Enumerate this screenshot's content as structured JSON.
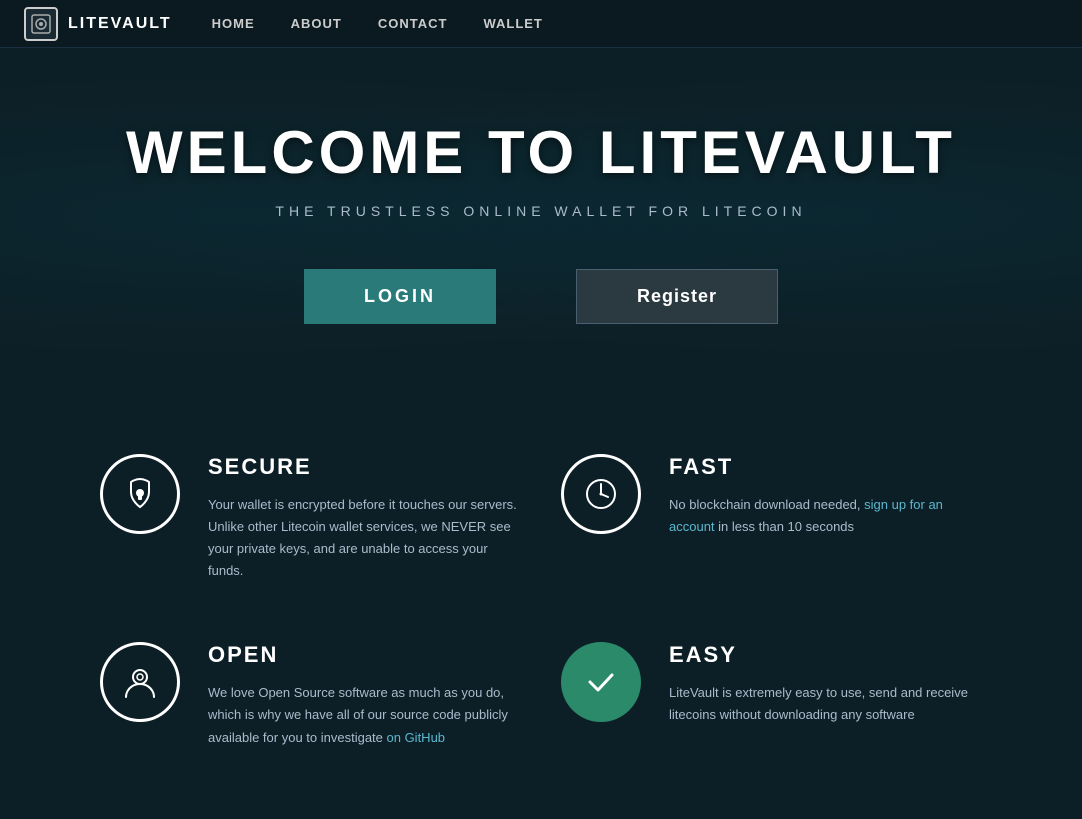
{
  "nav": {
    "logo_text": "LITEVAULT",
    "links": [
      {
        "label": "HOME",
        "id": "home"
      },
      {
        "label": "ABOUT",
        "id": "about"
      },
      {
        "label": "CONTACT",
        "id": "contact"
      },
      {
        "label": "WALLET",
        "id": "wallet"
      }
    ]
  },
  "hero": {
    "title": "WELCOME TO LITEVAULT",
    "subtitle": "THE TRUSTLESS ONLINE WALLET FOR LITECOIN",
    "login_label": "LOGIN",
    "register_label": "Register"
  },
  "features": [
    {
      "id": "secure",
      "icon": "lock",
      "title": "SECURE",
      "text": "Your wallet is encrypted before it touches our servers. Unlike other Litecoin wallet services, we NEVER see your private keys, and are unable to access your funds.",
      "link": null,
      "link_text": null,
      "after_link": null
    },
    {
      "id": "fast",
      "icon": "clock",
      "title": "FAST",
      "text_before": "No blockchain download needed, ",
      "link": "sign up for an account",
      "text_after": " in less than 10 seconds",
      "link_url": "#"
    },
    {
      "id": "open",
      "icon": "openid",
      "title": "OPEN",
      "text_before": "We love Open Source software as much as you do, which is why we have all of our source code publicly available for you to investigate ",
      "link": "on GitHub",
      "text_after": "",
      "link_url": "#"
    },
    {
      "id": "easy",
      "icon": "check",
      "title": "EASY",
      "text": "LiteVault is extremely easy to use, send and receive litecoins without downloading any software",
      "link": null
    }
  ]
}
